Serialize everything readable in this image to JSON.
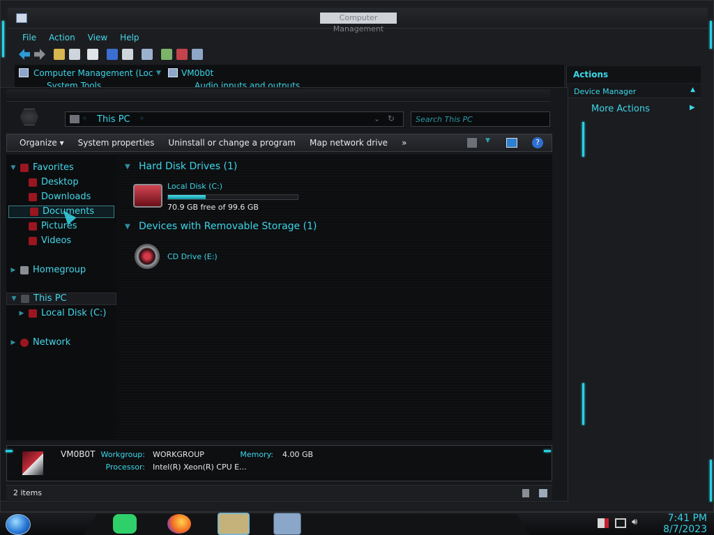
{
  "cm": {
    "title": "Computer Management",
    "menu": [
      "File",
      "Action",
      "View",
      "Help"
    ],
    "tree_left": "Computer Management (Loc",
    "tree_left2": "System Tools",
    "tree_right": "VM0b0t",
    "tree_right2": "Audio inputs and outputs"
  },
  "actions": {
    "header": "Actions",
    "device": "Device Manager",
    "more": "More Actions",
    "more_arrow": "▶",
    "collapse": "▲"
  },
  "explorer": {
    "address": "This PC",
    "search_placeholder": "Search This PC",
    "commands": [
      "Organize ▾",
      "System properties",
      "Uninstall or change a program",
      "Map network drive",
      "»"
    ],
    "nav": {
      "favorites": "Favorites",
      "desktop": "Desktop",
      "downloads": "Downloads",
      "documents": "Documents",
      "pictures": "Pictures",
      "videos": "Videos",
      "homegroup": "Homegroup",
      "thispc": "This PC",
      "localdisk": "Local Disk (C:)",
      "network": "Network"
    },
    "groups": {
      "hdd": "Hard Disk Drives (1)",
      "removable": "Devices with Removable Storage (1)"
    },
    "drives": {
      "c_name": "Local Disk (C:)",
      "c_free": "70.9 GB free of 99.6 GB",
      "c_used_fraction": 0.288,
      "e_name": "CD Drive (E:)"
    },
    "details": {
      "name": "VM0B0T",
      "workgroup_label": "Workgroup:",
      "workgroup": "WORKGROUP",
      "memory_label": "Memory:",
      "memory": "4.00 GB",
      "processor_label": "Processor:",
      "processor": "Intel(R) Xeon(R) CPU E..."
    },
    "status": "2 items"
  },
  "taskbar": {
    "time": "7:41 PM",
    "date": "8/7/2023"
  },
  "colors": {
    "accent": "#37d6e6",
    "bg": "#0c0d0f"
  }
}
